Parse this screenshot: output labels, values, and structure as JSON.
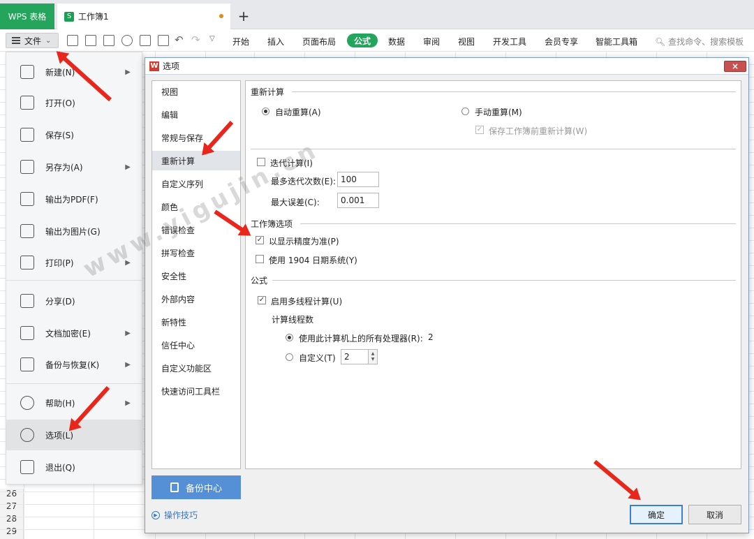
{
  "titlebar": {
    "app": "WPS 表格",
    "book_icon": "S",
    "book_title": "工作簿1",
    "add": "+"
  },
  "toolbar": {
    "file_label": "文件",
    "tabs": [
      "开始",
      "插入",
      "页面布局",
      "公式",
      "数据",
      "审阅",
      "视图",
      "开发工具",
      "会员专享",
      "智能工具箱"
    ],
    "active_tab": "公式",
    "search_placeholder": "查找命令、搜索模板"
  },
  "file_menu": {
    "items": [
      {
        "label": "新建(N)",
        "icon": "new-file-icon",
        "arrow": true
      },
      {
        "label": "打开(O)",
        "icon": "folder-icon",
        "arrow": false
      },
      {
        "label": "保存(S)",
        "icon": "save-icon",
        "arrow": false
      },
      {
        "label": "另存为(A)",
        "icon": "save-as-icon",
        "arrow": true
      },
      {
        "label": "输出为PDF(F)",
        "icon": "pdf-icon",
        "arrow": false
      },
      {
        "label": "输出为图片(G)",
        "icon": "image-icon",
        "arrow": false
      },
      {
        "label": "打印(P)",
        "icon": "print-icon",
        "arrow": true
      },
      {
        "label": "分享(D)",
        "icon": "share-icon",
        "arrow": false
      },
      {
        "label": "文档加密(E)",
        "icon": "encrypt-icon",
        "arrow": true
      },
      {
        "label": "备份与恢复(K)",
        "icon": "backup-icon",
        "arrow": true
      },
      {
        "label": "帮助(H)",
        "icon": "help-icon",
        "arrow": true
      },
      {
        "label": "选项(L)",
        "icon": "gear-icon",
        "arrow": false,
        "selected": true
      },
      {
        "label": "退出(Q)",
        "icon": "exit-icon",
        "arrow": false
      }
    ]
  },
  "sheet": {
    "row_numbers": [
      "26",
      "27",
      "28",
      "29"
    ]
  },
  "dialog": {
    "title": "选项",
    "close": "×",
    "nav": [
      "视图",
      "编辑",
      "常规与保存",
      "重新计算",
      "自定义序列",
      "颜色",
      "错误检查",
      "拼写检查",
      "安全性",
      "外部内容",
      "新特性",
      "信任中心",
      "自定义功能区",
      "快速访问工具栏"
    ],
    "nav_selected": "重新计算",
    "backup_center": "备份中心",
    "tips": "操作技巧",
    "sections": {
      "recalc": {
        "title": "重新计算",
        "auto": "自动重算(A)",
        "manual": "手动重算(M)",
        "save_recalc": "保存工作簿前重新计算(W)",
        "iterate": "迭代计算(I)",
        "max_iter_label": "最多迭代次数(E):",
        "max_iter_value": "100",
        "max_err_label": "最大误差(C):",
        "max_err_value": "0.001"
      },
      "workbook": {
        "title": "工作簿选项",
        "precision": "以显示精度为准(P)",
        "date1904": "使用 1904 日期系统(Y)"
      },
      "formula": {
        "title": "公式",
        "multithread": "启用多线程计算(U)",
        "threads_label": "计算线程数",
        "use_all": "使用此计算机上的所有处理器(R):",
        "use_all_value": "2",
        "custom": "自定义(T)",
        "custom_value": "2"
      }
    },
    "ok": "确定",
    "cancel": "取消"
  },
  "watermark": "www.yigujin.cn",
  "accent": "#23a55d",
  "arrow_color": "#e8261c"
}
